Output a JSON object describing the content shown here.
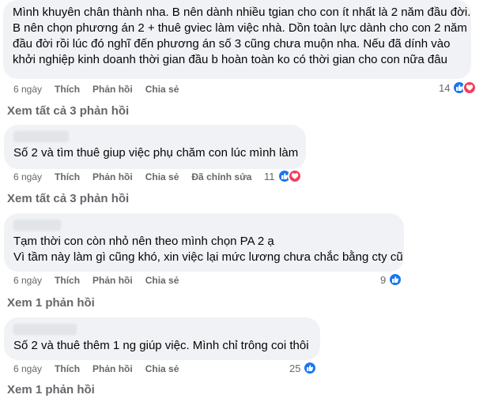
{
  "comments": [
    {
      "lines": [
        "Mình khuyên chân thành nha. B nên dành nhiều tgian cho con ít nhất là 2 năm đầu đời.",
        "B nên chọn phương án 2 + thuê gviec làm việc nhà. Dồn toàn lực dành cho con 2 năm",
        "đầu đời rồi lúc đó nghĩ đến phương án số 3 cũng chưa muộn nha. Nếu đã dính vào",
        "khởi nghiệp kinh doanh thời gian đầu b hoàn toàn ko có thời gian cho con nữa đâu"
      ],
      "time": "6 ngày",
      "like": "Thích",
      "reply": "Phản hồi",
      "share": "Chia sẻ",
      "edited": "",
      "reactions": "14",
      "view_replies": "Xem tất cả 3 phản hồi"
    },
    {
      "lines": [
        "Số 2 và tìm thuê giup việc phụ chăm con lúc mình làm"
      ],
      "time": "6 ngày",
      "like": "Thích",
      "reply": "Phản hồi",
      "share": "Chia sẻ",
      "edited": "Đã chỉnh sửa",
      "reactions": "11",
      "view_replies": "Xem tất cả 3 phản hồi"
    },
    {
      "lines": [
        "Tạm thời con còn nhỏ nên theo mình chọn PA 2 ạ",
        "Vì tầm này làm gì cũng khó, xin việc lại mức lương chưa chắc bằng cty cũ"
      ],
      "time": "6 ngày",
      "like": "Thích",
      "reply": "Phản hồi",
      "share": "Chia sẻ",
      "edited": "",
      "reactions": "9",
      "view_replies": "Xem 1 phản hồi"
    },
    {
      "lines": [
        "Số 2 và thuê thêm 1 ng giúp việc. Mình chỉ trông coi thôi"
      ],
      "time": "6 ngày",
      "like": "Thích",
      "reply": "Phản hồi",
      "share": "Chia sẻ",
      "edited": "",
      "reactions": "25",
      "view_replies": "Xem 1 phản hồi"
    }
  ],
  "colors": {
    "like": "#1877f2",
    "love": "#f33e58",
    "bubble": "#f0f2f5",
    "meta": "#65676b"
  },
  "icons": {
    "like": "thumbs-up-icon",
    "love": "heart-icon"
  }
}
